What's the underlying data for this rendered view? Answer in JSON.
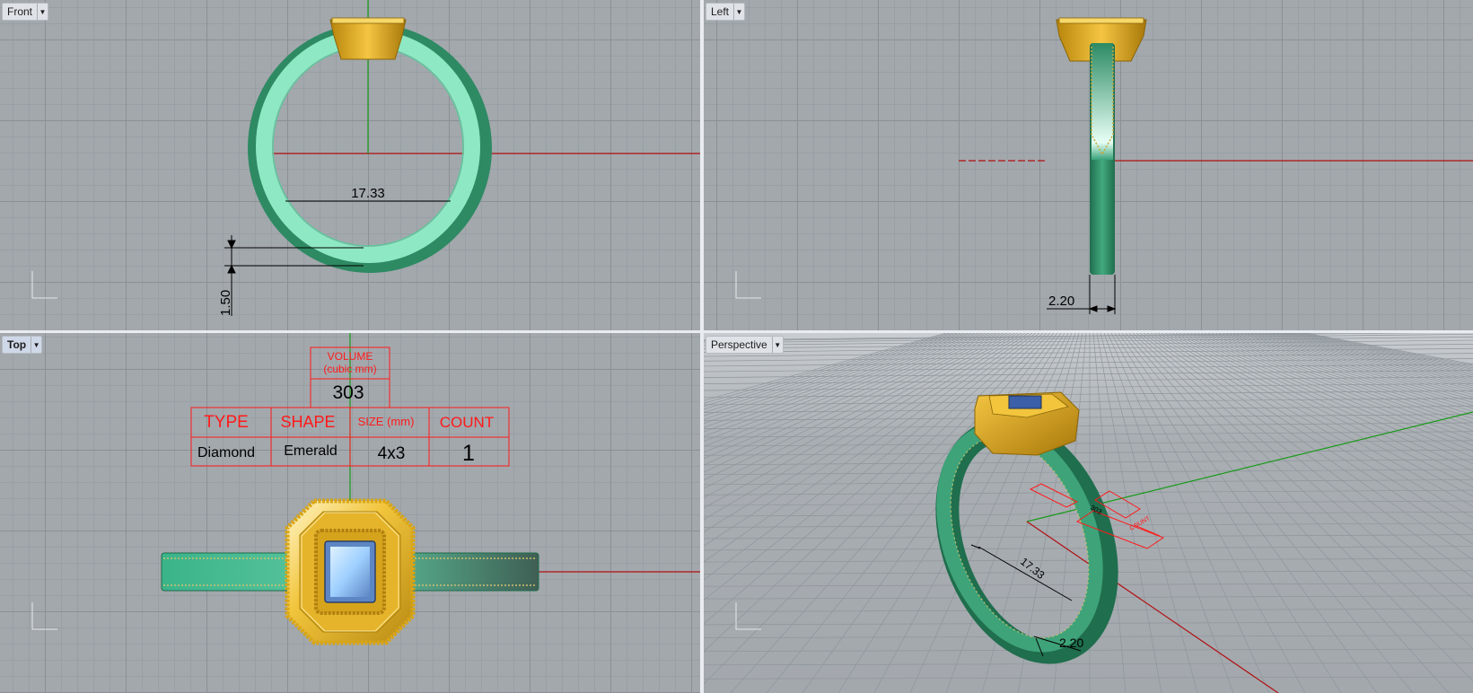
{
  "viewports": {
    "front": {
      "label": "Front"
    },
    "left": {
      "label": "Left"
    },
    "top": {
      "label": "Top"
    },
    "perspective": {
      "label": "Perspective"
    }
  },
  "dimensions": {
    "inner_diameter": "17.33",
    "band_thickness": "1.50",
    "band_width": "2.20"
  },
  "spec_table": {
    "volume_label_line1": "VOLUME",
    "volume_label_line2": "(cubic mm)",
    "volume_value": "303",
    "headers": [
      "TYPE",
      "SHAPE",
      "SIZE (mm)",
      "COUNT"
    ],
    "row": [
      "Diamond",
      "Emerald",
      "4x3",
      "1"
    ]
  },
  "perspective_annotations": {
    "diameter": "17.33",
    "width": "2.20",
    "volume": "303",
    "count_label": "COUNT"
  },
  "colors": {
    "viewport_bg": "#a3a8ad",
    "band_light": "#8ee8c4",
    "band_dark": "#2e8a63",
    "gold": "#e0a81c",
    "stone": "#9fd0ff",
    "x_axis": "#b01010",
    "y_axis": "#1a9a1a",
    "annotation": "#ff1a1a"
  }
}
